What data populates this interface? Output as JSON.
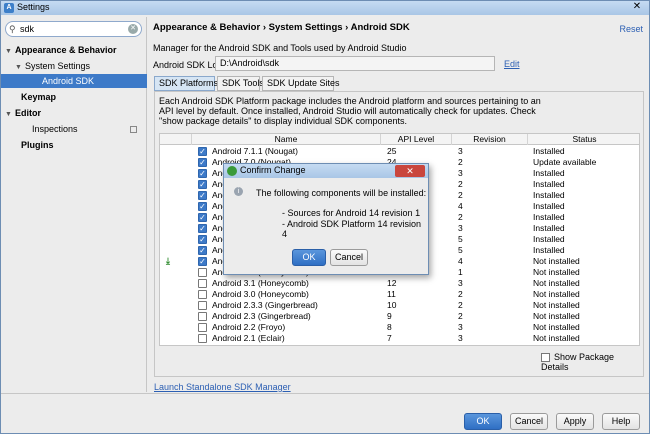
{
  "window": {
    "title": "Settings",
    "close": "✕"
  },
  "sidebar": {
    "search_value": "sdk",
    "items": [
      {
        "label": "Appearance & Behavior"
      },
      {
        "label": "System Settings"
      },
      {
        "label": "Android SDK"
      },
      {
        "label": "Keymap"
      },
      {
        "label": "Editor"
      },
      {
        "label": "Inspections"
      },
      {
        "label": "Plugins"
      }
    ]
  },
  "content": {
    "breadcrumb": "Appearance & Behavior › System Settings › Android SDK",
    "reset": "Reset",
    "description": "Manager for the Android SDK and Tools used by Android Studio",
    "location_label": "Android SDK Location:",
    "location_value": "D:\\Android\\sdk",
    "edit": "Edit",
    "tabs": [
      {
        "label": "SDK Platforms"
      },
      {
        "label": "SDK Tools"
      },
      {
        "label": "SDK Update Sites"
      }
    ],
    "panel_description": "Each Android SDK Platform package includes the Android platform and sources pertaining to an API level by default. Once installed, Android Studio will automatically check for updates. Check \"show package details\" to display individual SDK components.",
    "table": {
      "headers": [
        "Name",
        "API Level",
        "Revision",
        "Status"
      ],
      "rows": [
        {
          "name": "Android 7.1.1 (Nougat)",
          "api": "25",
          "rev": "3",
          "status": "Installed",
          "checked": true
        },
        {
          "name": "Android 7.0 (Nougat)",
          "api": "24",
          "rev": "2",
          "status": "Update available",
          "checked": true
        },
        {
          "name": "Andro",
          "api": "",
          "rev": "3",
          "status": "Installed",
          "checked": true
        },
        {
          "name": "Andro",
          "api": "",
          "rev": "2",
          "status": "Installed",
          "checked": true
        },
        {
          "name": "Andro",
          "api": "",
          "rev": "2",
          "status": "Installed",
          "checked": true
        },
        {
          "name": "Andro",
          "api": "",
          "rev": "4",
          "status": "Installed",
          "checked": true
        },
        {
          "name": "Andro",
          "api": "",
          "rev": "2",
          "status": "Installed",
          "checked": true
        },
        {
          "name": "Andro",
          "api": "",
          "rev": "3",
          "status": "Installed",
          "checked": true
        },
        {
          "name": "Andro",
          "api": "",
          "rev": "5",
          "status": "Installed",
          "checked": true
        },
        {
          "name": "Andro",
          "api": "",
          "rev": "5",
          "status": "Installed",
          "checked": true
        },
        {
          "name": "Andro",
          "api": "",
          "rev": "4",
          "status": "Not installed",
          "checked": true
        },
        {
          "name": "Android 3.2 (Honeycomb)",
          "api": "13",
          "rev": "1",
          "status": "Not installed",
          "checked": false
        },
        {
          "name": "Android 3.1 (Honeycomb)",
          "api": "12",
          "rev": "3",
          "status": "Not installed",
          "checked": false
        },
        {
          "name": "Android 3.0 (Honeycomb)",
          "api": "11",
          "rev": "2",
          "status": "Not installed",
          "checked": false
        },
        {
          "name": "Android 2.3.3 (Gingerbread)",
          "api": "10",
          "rev": "2",
          "status": "Not installed",
          "checked": false
        },
        {
          "name": "Android 2.3 (Gingerbread)",
          "api": "9",
          "rev": "2",
          "status": "Not installed",
          "checked": false
        },
        {
          "name": "Android 2.2 (Froyo)",
          "api": "8",
          "rev": "3",
          "status": "Not installed",
          "checked": false
        },
        {
          "name": "Android 2.1 (Eclair)",
          "api": "7",
          "rev": "3",
          "status": "Not installed",
          "checked": false
        }
      ]
    },
    "show_details": "Show Package Details",
    "launch_link": "Launch Standalone SDK Manager"
  },
  "footer": {
    "ok": "OK",
    "cancel": "Cancel",
    "apply": "Apply",
    "help": "Help"
  },
  "dialog": {
    "title": "Confirm Change",
    "message": "The following components will be installed:",
    "items": [
      "- Sources for Android 14 revision 1",
      "- Android SDK Platform 14 revision 4"
    ],
    "ok": "OK",
    "cancel": "Cancel"
  }
}
